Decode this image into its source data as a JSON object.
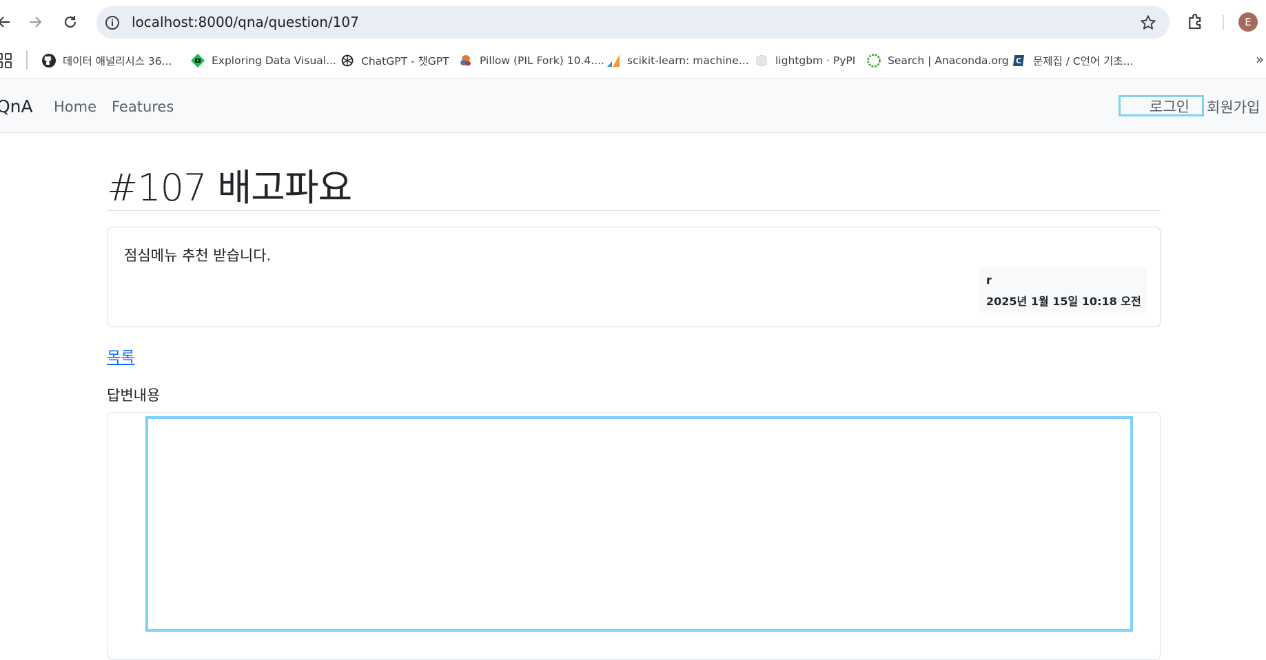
{
  "browser": {
    "url_host": "localhost",
    "url_path": ":8000/qna/question/107",
    "profile_initial": "E",
    "bookmarks": [
      {
        "label": "데이터 애널리시스 36...",
        "icon": "github-icon"
      },
      {
        "label": "Exploring Data Visual...",
        "icon": "exploring-data-icon"
      },
      {
        "label": "ChatGPT - 챗GPT",
        "icon": "openai-icon"
      },
      {
        "label": "Pillow (PIL Fork) 10.4....",
        "icon": "pillow-icon"
      },
      {
        "label": "scikit-learn: machine...",
        "icon": "scikit-learn-icon"
      },
      {
        "label": "lightgbm · PyPI",
        "icon": "pypi-icon"
      },
      {
        "label": "Search | Anaconda.org",
        "icon": "anaconda-icon"
      },
      {
        "label": "문제집 / C언어 기초...",
        "icon": "codeup-icon"
      }
    ],
    "bookmarks_more": "»"
  },
  "app": {
    "brand": "QnA",
    "nav": {
      "home": "Home",
      "features": "Features"
    },
    "login": "로그인",
    "signup": "회원가입"
  },
  "question": {
    "title": "#107 배고파요",
    "body": "점심메뉴 추천 받습니다.",
    "author": "r",
    "date": "2025년 1월 15일 10:18 오전"
  },
  "links": {
    "list": "목록"
  },
  "answer": {
    "label": "답변내용",
    "value": ""
  }
}
